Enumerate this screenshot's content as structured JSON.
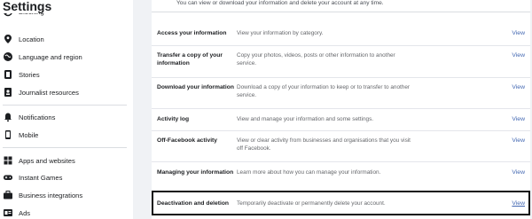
{
  "sidebar": {
    "title": "Settings",
    "items": [
      {
        "label": "Blocking"
      },
      {
        "label": "Location"
      },
      {
        "label": "Language and region"
      },
      {
        "label": "Stories"
      },
      {
        "label": "Journalist resources"
      },
      {
        "label": "Notifications"
      },
      {
        "label": "Mobile"
      },
      {
        "label": "Apps and websites"
      },
      {
        "label": "Instant Games"
      },
      {
        "label": "Business integrations"
      },
      {
        "label": "Ads"
      }
    ]
  },
  "main": {
    "intro": "You can view or download your information and delete your account at any time.",
    "rows": [
      {
        "label": "Access your information",
        "desc": "View your information by category.",
        "link": "View"
      },
      {
        "label": "Transfer a copy of your information",
        "desc": "Copy your photos, videos, posts or other information to another service.",
        "link": "View"
      },
      {
        "label": "Download your information",
        "desc": "Download a copy of your information to keep or to transfer to another service.",
        "link": "View"
      },
      {
        "label": "Activity log",
        "desc": "View and manage your information and some settings.",
        "link": "View"
      },
      {
        "label": "Off-Facebook activity",
        "desc": "View or clear activity from businesses and organisations that you visit off Facebook.",
        "link": "View"
      },
      {
        "label": "Managing your information",
        "desc": "Learn more about how you can manage your information.",
        "link": "View"
      },
      {
        "label": "Deactivation and deletion",
        "desc": "Temporarily deactivate or permanently delete your account.",
        "link": "View"
      }
    ]
  }
}
